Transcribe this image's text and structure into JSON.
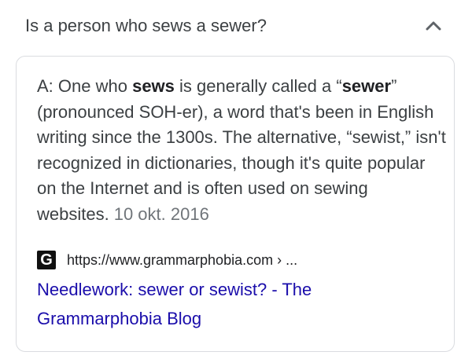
{
  "question": "Is a person who sews a sewer?",
  "collapse_icon": "chevron-up-icon",
  "answer": {
    "prefix": "A: One who ",
    "bold1": "sews",
    "middle1": " is generally called a “",
    "bold2": "sewer",
    "rest": "” (pronounced SOH-er), a word that's been in English writing since the 1300s. The alternative, “sewist,” isn't recognized in dictionaries, though it's quite popular on the Internet and is often used on sewing websites.",
    "date": "10 okt. 2016"
  },
  "source": {
    "favicon_letter": "G",
    "url": "https://www.grammarphobia.com › ...",
    "title_line1": "Needlework: sewer or sewist? - The",
    "title_line2": "Grammarphobia Blog"
  },
  "colors": {
    "link": "#1a0dab",
    "text": "#3c4043",
    "muted": "#70757a",
    "border": "#dadce0"
  }
}
